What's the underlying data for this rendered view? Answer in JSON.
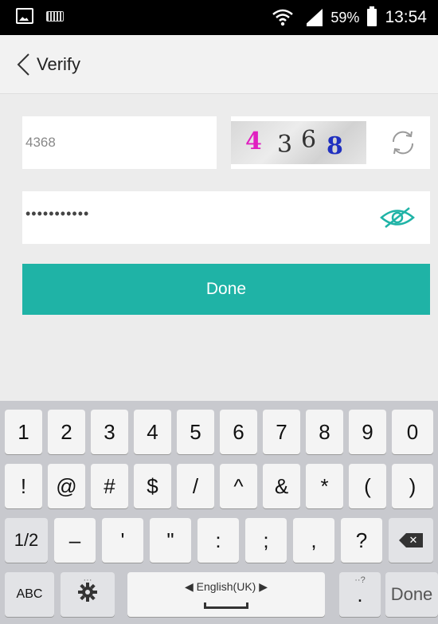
{
  "status_bar": {
    "battery_percent": "59%",
    "time": "13:54",
    "icons": [
      "gallery-icon",
      "keyboard-icon",
      "wifi-icon",
      "signal-icon",
      "battery-icon"
    ]
  },
  "header": {
    "title": "Verify",
    "back_icon": "chevron-left-icon"
  },
  "form": {
    "captcha_value": "4368",
    "captcha_image_digits": [
      "4",
      "3",
      "6",
      "8"
    ],
    "captcha_digit_colors": [
      "#e020c0",
      "#333333",
      "#333333",
      "#2030c0"
    ],
    "refresh_icon": "refresh-icon",
    "password_masked": "•••••••••••",
    "eye_icon": "eye-slash-icon",
    "done_label": "Done",
    "accent_color": "#1fb3a6"
  },
  "keyboard": {
    "row1": [
      "1",
      "2",
      "3",
      "4",
      "5",
      "6",
      "7",
      "8",
      "9",
      "0"
    ],
    "row2": [
      "!",
      "@",
      "#",
      "$",
      "/",
      "^",
      "&",
      "*",
      "(",
      ")"
    ],
    "row3": [
      "1/2",
      "–",
      "'",
      "\"",
      ":",
      ";",
      ",",
      "?"
    ],
    "row3_backspace_icon": "backspace-icon",
    "abc_label": "ABC",
    "settings_icon": "gear-icon",
    "space_label": "English(UK)",
    "period_label": ".",
    "period_hint": "··?",
    "done_label": "Done",
    "arrow_left": "◀",
    "arrow_right": "▶"
  }
}
